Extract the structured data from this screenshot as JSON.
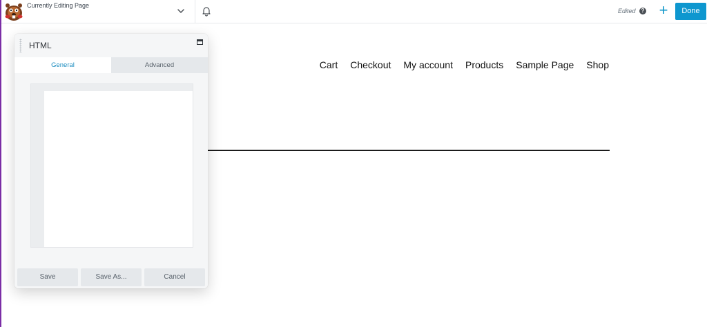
{
  "topbar": {
    "editing_label": "Currently Editing Page",
    "edited_label": "Edited",
    "help_glyph": "?",
    "add_glyph": "+",
    "done_label": "Done",
    "accent_color": "#0e97cf"
  },
  "nav": {
    "items": [
      "Cart",
      "Checkout",
      "My account",
      "Products",
      "Sample Page",
      "Shop"
    ]
  },
  "panel": {
    "title": "HTML",
    "tabs": [
      {
        "label": "General",
        "active": true
      },
      {
        "label": "Advanced",
        "active": false
      }
    ],
    "editor_value": "",
    "buttons": {
      "save": "Save",
      "save_as": "Save As...",
      "cancel": "Cancel"
    }
  },
  "icons": {
    "logo": "beaver-logo-icon",
    "chevron": "chevron-down-icon",
    "bell": "bell-icon",
    "help": "help-icon",
    "add": "plus-icon",
    "maximize": "maximize-icon",
    "drag": "drag-handle-icon"
  }
}
